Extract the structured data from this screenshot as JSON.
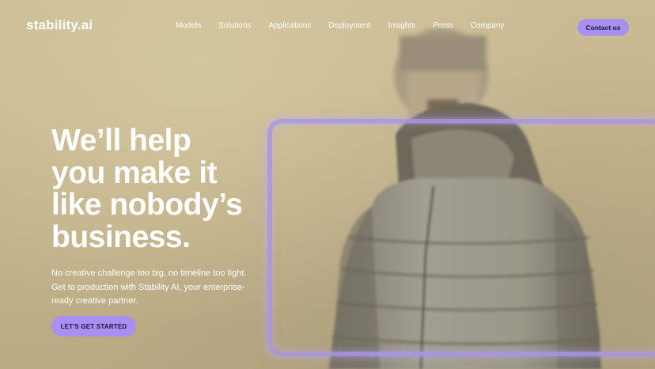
{
  "brand": {
    "logo_text": "stability.ai"
  },
  "nav": {
    "items": [
      "Models",
      "Solutions",
      "Applications",
      "Deployment",
      "Insights",
      "Press",
      "Company"
    ],
    "contact_label": "Contact us"
  },
  "hero": {
    "headline_lines": [
      "We’ll help",
      "you make it",
      "like nobody’s",
      "business."
    ],
    "subtext_lines": [
      "No creative challenge too big, no timeline too tight.",
      "Get to production with Stability AI, your enterprise-",
      "ready creative partner."
    ],
    "cta_label": "LET'S GET STARTED"
  },
  "colors": {
    "accent": "#a88ff2",
    "background": "#c4b48e",
    "frame": "#aa96e6"
  }
}
